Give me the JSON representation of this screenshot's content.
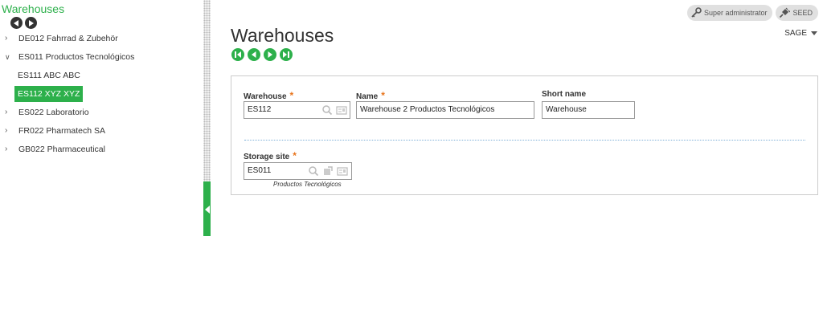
{
  "left": {
    "title": "Warehouses",
    "tree": [
      {
        "label": "DE012 Fahrrad & Zubehör",
        "expanded": false,
        "level": 0
      },
      {
        "label": "ES011 Productos Tecnológicos",
        "expanded": true,
        "level": 0
      },
      {
        "label": "ES111 ABC ABC",
        "level": 1
      },
      {
        "label": "ES112 XYZ XYZ",
        "level": 1,
        "selected": true
      },
      {
        "label": "ES022 Laboratorio",
        "expanded": false,
        "level": 0
      },
      {
        "label": "FR022 Pharmatech SA",
        "expanded": false,
        "level": 0
      },
      {
        "label": "GB022 Pharmaceutical",
        "expanded": false,
        "level": 0
      }
    ]
  },
  "header": {
    "user_label": "Super administrator",
    "folder_label": "SEED",
    "company_label": "SAGE"
  },
  "main": {
    "title": "Warehouses",
    "form": {
      "warehouse": {
        "label": "Warehouse",
        "required_mark": "*",
        "value": "ES112"
      },
      "name": {
        "label": "Name",
        "required_mark": "*",
        "value": "Warehouse 2 Productos Tecnológicos"
      },
      "short_name": {
        "label": "Short name",
        "value": "Warehouse"
      },
      "storage_site": {
        "label": "Storage site",
        "required_mark": "*",
        "value": "ES011",
        "caption": "Productos Tecnológicos"
      }
    }
  },
  "colors": {
    "accent": "#2db04b",
    "required": "#e8731a"
  }
}
